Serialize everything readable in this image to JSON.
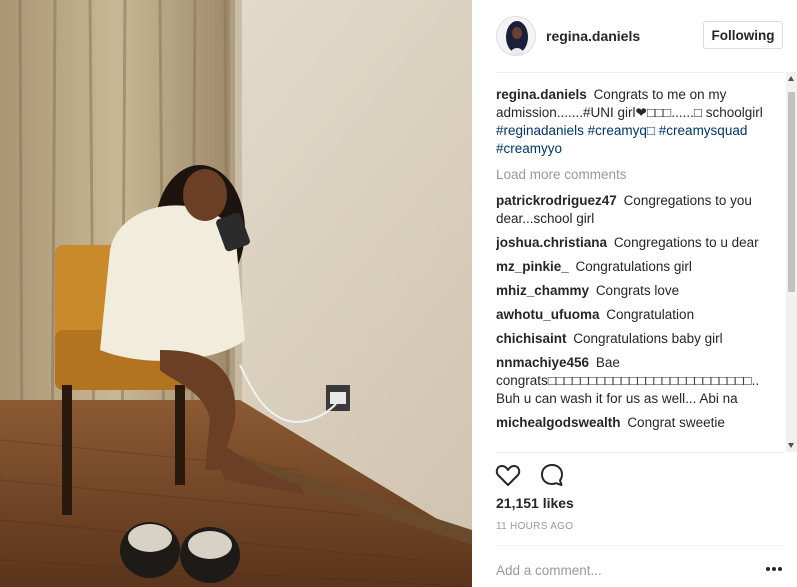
{
  "post": {
    "username": "regina.daniels",
    "follow_label": "Following",
    "caption": {
      "username": "regina.daniels",
      "text": "Congrats to me on my admission.......#UNI girl❤□□□......□ schoolgirl",
      "hashtags": [
        "#reginadaniels",
        "#creamyq□",
        "#creamysquad",
        "#creamyyo"
      ]
    },
    "load_more": "Load more comments",
    "comments": [
      {
        "user": "patrickrodriguez47",
        "text": "Congregations to you dear...school girl"
      },
      {
        "user": "joshua.christiana",
        "text": "Congregations to u dear"
      },
      {
        "user": "mz_pinkie_",
        "text": "Congratulations girl"
      },
      {
        "user": "mhiz_chammy",
        "text": "Congrats love"
      },
      {
        "user": "awhotu_ufuoma",
        "text": "Congratulation"
      },
      {
        "user": "chichisaint",
        "text": "Congratulations baby girl"
      },
      {
        "user": "nnmachiye456",
        "text": "Bae congrats□□□□□□□□□□□□□□□□□□□□□□□□□.. Buh u can wash it for us as well... Abi na"
      },
      {
        "user": "michealgodswealth",
        "text": "Congrat sweetie"
      }
    ],
    "likes": "21,151 likes",
    "time": "11 HOURS AGO",
    "add_comment_placeholder": "Add a comment...",
    "icons": {
      "like": "heart-icon",
      "comment": "speech-bubble-icon",
      "more": "more-options-icon"
    }
  }
}
